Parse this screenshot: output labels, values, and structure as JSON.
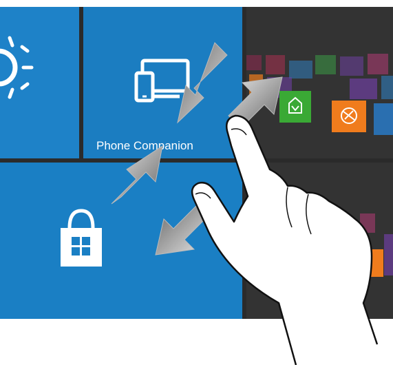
{
  "tiles": {
    "weather": {
      "icon": "sun-icon"
    },
    "phone_companion": {
      "label": "Phone Companion",
      "icon": "devices-icon"
    },
    "store": {
      "icon": "store-bag-icon"
    }
  },
  "right_pane_tiles": [
    {
      "icon": "app-icon-green",
      "color": "#3aa935"
    },
    {
      "icon": "app-icon-orange",
      "color": "#f07c1d"
    }
  ],
  "gesture": {
    "type": "pinch-zoom",
    "icon": "hand-icon"
  },
  "colors": {
    "tile_blue": "#1b7dc1",
    "background": "#2b2b2b",
    "arrow_gray": "#777777"
  }
}
